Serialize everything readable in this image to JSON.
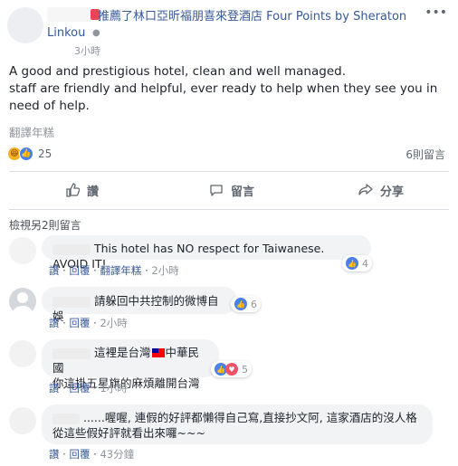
{
  "post": {
    "title": "推薦了林口亞昕福朋喜來登酒店 Four Points by Sheraton",
    "location": "Linkou",
    "time": "3小時",
    "text": "A good and prestigious hotel, clean and well managed.\nstaff are friendly and helpful, ever ready to help when they see you in need of help.",
    "translate": "翻譯年糕",
    "reactions_count": "25",
    "comments_count": "6則留言"
  },
  "actions": {
    "like": "讚",
    "comment": "留言",
    "share": "分享"
  },
  "view_more": "檢視另2則留言",
  "comments": [
    {
      "text": "This hotel has NO respect for Taiwanese. AVOID IT!",
      "like": "讚",
      "reply": "回覆",
      "translate": "翻譯年糕",
      "time": "2小時",
      "reactions": "4"
    },
    {
      "text": "請躲回中共控制的微博自娛",
      "like": "讚",
      "reply": "回覆",
      "time": "2小時",
      "reactions": "6"
    },
    {
      "line1_pre": "這裡是台灣",
      "line1_post": "中華民國",
      "line2": "你這掛五星旗的麻煩離開台灣",
      "like": "讚",
      "reply": "回覆",
      "time": "1小時",
      "reactions": "5"
    },
    {
      "line1": "......喔喔, 連假的好評都懶得自己寫,直接抄文阿, 這家酒店的沒人格",
      "line2": "從這些假好評就看出來囉~~~",
      "like": "讚",
      "reply": "回覆",
      "time": "43分鐘"
    }
  ],
  "colors": {
    "link": "#365899",
    "like_blue": "#4a80ed",
    "love_red": "#f25268",
    "haha_yellow": "#f7b125"
  }
}
